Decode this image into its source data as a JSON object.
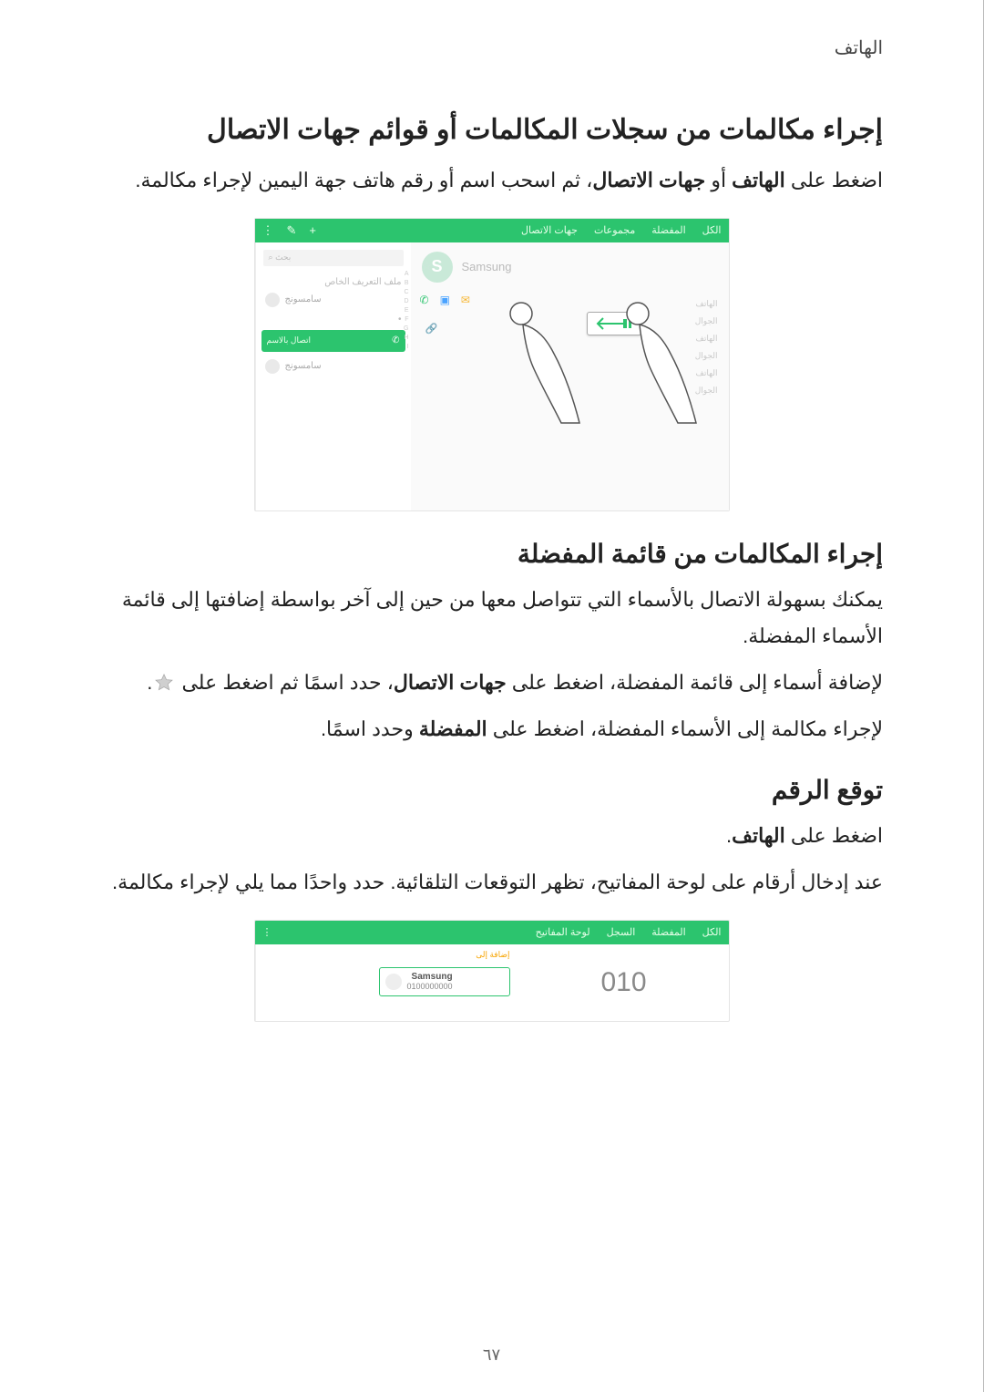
{
  "header": {
    "chapter": "الهاتف"
  },
  "section1": {
    "title": "إجراء مكالمات من سجلات المكالمات أو قوائم جهات الاتصال",
    "para_before": "اضغط على ",
    "bold1": "الهاتف",
    "mid1": " أو ",
    "bold2": "جهات الاتصال",
    "after": "، ثم اسحب اسم أو رقم هاتف جهة اليمين لإجراء مكالمة."
  },
  "figure1": {
    "tabs": [
      "الكل",
      "المفضلة",
      "مجموعات",
      "جهات الاتصال"
    ],
    "icons": [
      "+",
      "✎",
      "⋮"
    ],
    "search_placeholder": "بحث",
    "pill1": "ملف التعريف الخاص",
    "contact_label": "سامسونج",
    "swipe_label": "اتصال بالاسم",
    "avatar_letter": "S",
    "name": "Samsung",
    "line1": "الهاتف",
    "line2": "الجوال",
    "star_icon": "star-outline-icon",
    "phone_icon": "phone-icon",
    "video_icon": "video-icon",
    "mail_icon": "mail-icon",
    "link_icon": "link-icon",
    "hand_icon": "pointer-hand-icon",
    "arrow_icon": "swipe-left-arrow-icon"
  },
  "section2": {
    "title": "إجراء المكالمات من قائمة المفضلة",
    "p1": "يمكنك بسهولة الاتصال بالأسماء التي تتواصل معها من حين إلى آخر بواسطة إضافتها إلى قائمة الأسماء المفضلة.",
    "p2_before": "لإضافة أسماء إلى قائمة المفضلة، اضغط على ",
    "p2_bold": "جهات الاتصال",
    "p2_mid": "، حدد اسمًا ثم اضغط على ",
    "p2_after": ".",
    "p3_before": "لإجراء مكالمة إلى الأسماء المفضلة، اضغط على ",
    "p3_bold": "المفضلة",
    "p3_after": " وحدد اسمًا."
  },
  "section3": {
    "title": "توقع الرقم",
    "p1_before": "اضغط على ",
    "p1_bold": "الهاتف",
    "p1_after": ".",
    "p2": "عند إدخال أرقام على لوحة المفاتيح، تظهر التوقعات التلقائية. حدد واحدًا مما يلي لإجراء مكالمة."
  },
  "figure2": {
    "tabs": [
      "الكل",
      "المفضلة",
      "السجل",
      "لوحة المفاتيح"
    ],
    "icons": [
      "⋮"
    ],
    "hint": "إضافة إلى",
    "suggest_name": "Samsung",
    "suggest_number": "0100000000",
    "typed": "010"
  },
  "page_number": "٦٧"
}
